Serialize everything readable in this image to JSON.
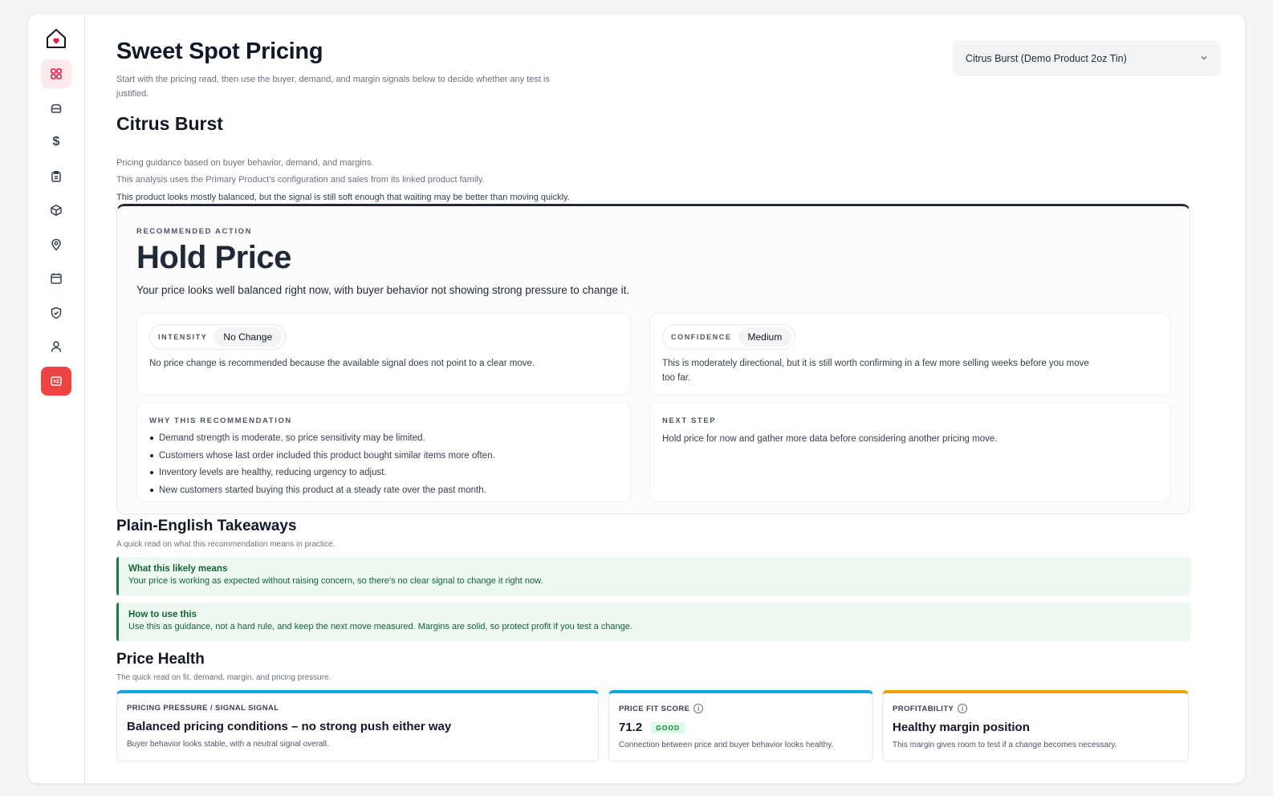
{
  "sidebar": {
    "items": [
      {
        "icon": "grid-icon",
        "state": "active-soft"
      },
      {
        "icon": "box-icon",
        "state": ""
      },
      {
        "icon": "dollar-icon",
        "state": ""
      },
      {
        "icon": "clipboard-icon",
        "state": ""
      },
      {
        "icon": "cube-icon",
        "state": ""
      },
      {
        "icon": "location-pin-icon",
        "state": ""
      },
      {
        "icon": "calendar-icon",
        "state": ""
      },
      {
        "icon": "shield-check-icon",
        "state": ""
      },
      {
        "icon": "user-icon",
        "state": ""
      },
      {
        "icon": "pricing-tag-icon",
        "state": "active-strong"
      }
    ],
    "dollar_glyph": "$"
  },
  "header": {
    "title": "Sweet Spot Pricing",
    "subtitle": "Start with the pricing read, then use the buyer, demand, and margin signals below to decide whether any test is justified.",
    "product_select": "Citrus Burst (Demo Product 2oz Tin)"
  },
  "product": {
    "name": "Citrus Burst",
    "line1": "Pricing guidance based on buyer behavior, demand, and margins.",
    "line2": "This analysis uses the Primary Product's configuration and sales from its linked product family.",
    "line3": "This product looks mostly balanced, but the signal is still soft enough that waiting may be better than moving quickly."
  },
  "recommendation": {
    "eyebrow": "Recommended Action",
    "title": "Hold Price",
    "description": "Your price looks well balanced right now, with buyer behavior not showing strong pressure to change it.",
    "intensity": {
      "label": "Intensity",
      "value": "No Change",
      "text": "No price change is recommended because the available signal does not point to a clear move."
    },
    "confidence": {
      "label": "Confidence",
      "value": "Medium",
      "text": "This is moderately directional, but it is still worth confirming in a few more selling weeks before you move too far."
    },
    "why": {
      "label": "Why this recommendation",
      "bullets": [
        "Demand strength is moderate, so price sensitivity may be limited.",
        "Customers whose last order included this product bought similar items more often.",
        "Inventory levels are healthy, reducing urgency to adjust.",
        "New customers started buying this product at a steady rate over the past month."
      ]
    },
    "next_step": {
      "label": "Next step",
      "text": "Hold price for now and gather more data before considering another pricing move."
    }
  },
  "takeaways": {
    "title": "Plain-English Takeaways",
    "subtitle": "A quick read on what this recommendation means in practice.",
    "items": [
      {
        "heading": "What this likely means",
        "body": "Your price is working as expected without raising concern, so there's no clear signal to change it right now."
      },
      {
        "heading": "How to use this",
        "body": "Use this as guidance, not a hard rule, and keep the next move measured. Margins are solid, so protect profit if you test a change."
      }
    ]
  },
  "price_health": {
    "title": "Price Health",
    "subtitle": "The quick read on fit, demand, margin, and pricing pressure.",
    "cards": [
      {
        "eyebrow": "PRICING PRESSURE / SIGNAL SIGNAL",
        "value": "Balanced pricing conditions – no strong push either way",
        "desc": "Buyer behavior looks stable, with a neutral signal overall.",
        "accent": "#0ea5e9"
      },
      {
        "eyebrow": "PRICE FIT SCORE",
        "value": "71.2",
        "badge": "GOOD",
        "desc": "Connection between price and buyer behavior looks healthy.",
        "accent": "#0ea5e9"
      },
      {
        "eyebrow": "PROFITABILITY",
        "value": "Healthy margin position",
        "desc": "This margin gives room to test if a change becomes necessary.",
        "accent": "#f59e0b"
      }
    ],
    "info_glyph": "i"
  }
}
